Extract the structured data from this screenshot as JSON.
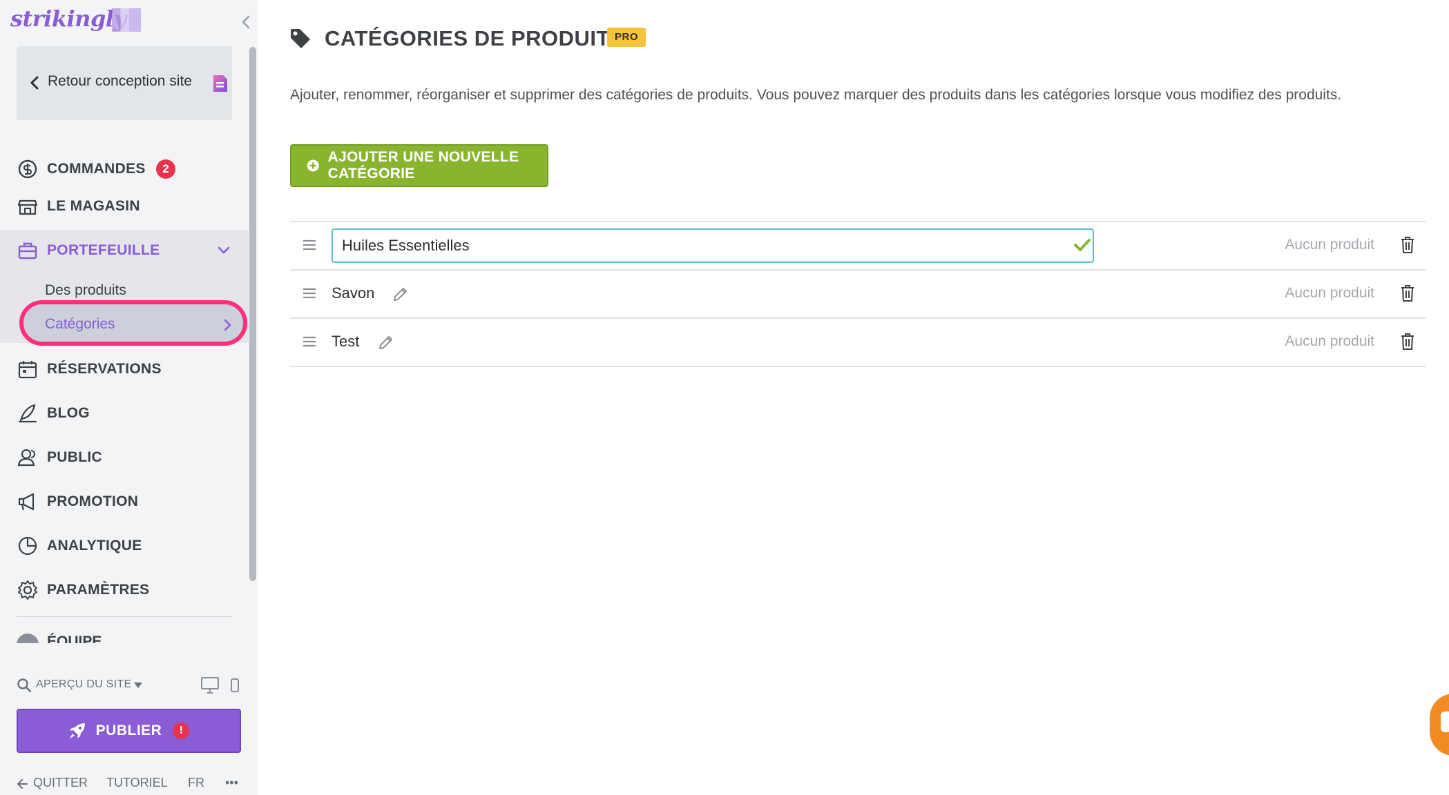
{
  "sidebar": {
    "logo": "strikingly",
    "back_label": "Retour conception site",
    "nav": {
      "orders": "COMMANDES",
      "orders_badge": "2",
      "store": "LE MAGASIN",
      "portfolio": "PORTEFEUILLE",
      "portfolio_sub": {
        "products": "Des produits",
        "categories": "Catégories"
      },
      "bookings": "RÉSERVATIONS",
      "blog": "BLOG",
      "audience": "PUBLIC",
      "promotion": "PROMOTION",
      "analytics": "ANALYTIQUE",
      "settings": "PARAMÈTRES",
      "team": "ÉQUIPE"
    },
    "preview_label": "APERÇU DU SITE",
    "publish_label": "PUBLIER",
    "publish_warning": "!",
    "footer": {
      "quit": "QUITTER",
      "tutorial": "TUTORIEL",
      "lang": "FR",
      "more": "•••"
    }
  },
  "main": {
    "title": "CATÉGORIES DE PRODUITS",
    "badge": "PRO",
    "description": "Ajouter, renommer, réorganiser et supprimer des catégories de produits. Vous pouvez marquer des produits dans les catégories lorsque vous modifiez des produits.",
    "add_button": "AJOUTER UNE NOUVELLE CATÉGORIE",
    "categories": [
      {
        "name": "Huiles Essentielles",
        "count": "Aucun produit",
        "editing": true
      },
      {
        "name": "Savon",
        "count": "Aucun produit",
        "editing": false
      },
      {
        "name": "Test",
        "count": "Aucun produit",
        "editing": false
      }
    ]
  },
  "colors": {
    "accent_purple": "#8a5cd6",
    "add_green": "#89b52e",
    "badge_red": "#e8334e",
    "pro_yellow": "#f7c33a",
    "highlight_pink": "#ff2f7b",
    "input_border": "#5dbacb"
  }
}
